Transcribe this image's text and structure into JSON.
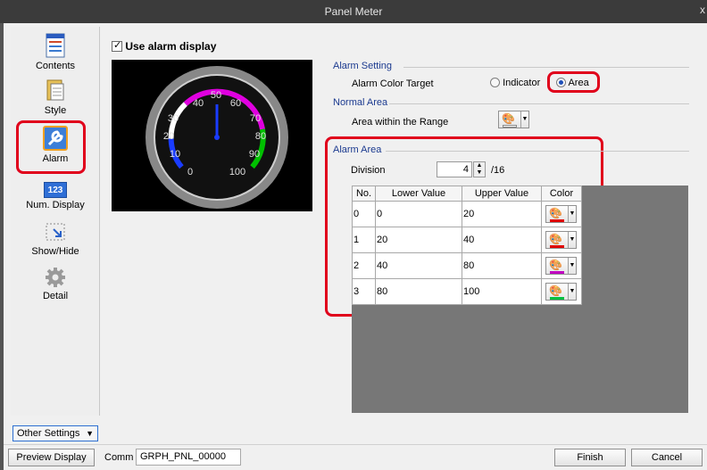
{
  "window": {
    "title": "Panel Meter",
    "close_glyph": "x"
  },
  "sidebar": {
    "items": [
      {
        "label": "Contents",
        "icon": "contents-icon"
      },
      {
        "label": "Style",
        "icon": "style-icon"
      },
      {
        "label": "Alarm",
        "icon": "alarm-wrench-icon",
        "selected": true
      },
      {
        "label": "Num. Display",
        "icon": "num-display-icon",
        "icon_text": "123"
      },
      {
        "label": "Show/Hide",
        "icon": "show-hide-icon"
      },
      {
        "label": "Detail",
        "icon": "gear-icon"
      }
    ],
    "other_settings": "Other Settings"
  },
  "main": {
    "use_alarm_label": "Use alarm display",
    "use_alarm_checked": true,
    "gauge": {
      "ticks": [
        "0",
        "10",
        "20",
        "30",
        "40",
        "50",
        "60",
        "70",
        "80",
        "90",
        "100"
      ],
      "needle_value": 50,
      "arc_colors": {
        "0_20": "#1a3cff",
        "20_40": "#ffffff",
        "40_80": "#e000e0",
        "80_100": "#00c000"
      }
    },
    "alarm_setting": {
      "title": "Alarm Setting",
      "color_target_label": "Alarm Color Target",
      "option_indicator": "Indicator",
      "option_area": "Area",
      "selected": "Area"
    },
    "normal_area": {
      "title": "Normal Area",
      "range_label": "Area within the Range"
    },
    "alarm_area": {
      "title": "Alarm Area",
      "division_label": "Division",
      "division_value": "4",
      "division_max": "/16",
      "columns": [
        "No.",
        "Lower Value",
        "Upper Value",
        "Color"
      ],
      "rows": [
        {
          "no": "0",
          "lower": "0",
          "upper": "20",
          "color": "#e00000"
        },
        {
          "no": "1",
          "lower": "20",
          "upper": "40",
          "color": "#e00000"
        },
        {
          "no": "2",
          "lower": "40",
          "upper": "80",
          "color": "#c000c0"
        },
        {
          "no": "3",
          "lower": "80",
          "upper": "100",
          "color": "#00c040"
        }
      ]
    }
  },
  "footer": {
    "preview_button": "Preview Display",
    "comm_label": "Comm",
    "comm_value": "GRPH_PNL_00000",
    "finish_button": "Finish",
    "cancel_button": "Cancel"
  },
  "colors": {
    "highlight": "#e0001b",
    "section_title": "#1b3a8f",
    "titlebar": "#3b3b3b"
  }
}
